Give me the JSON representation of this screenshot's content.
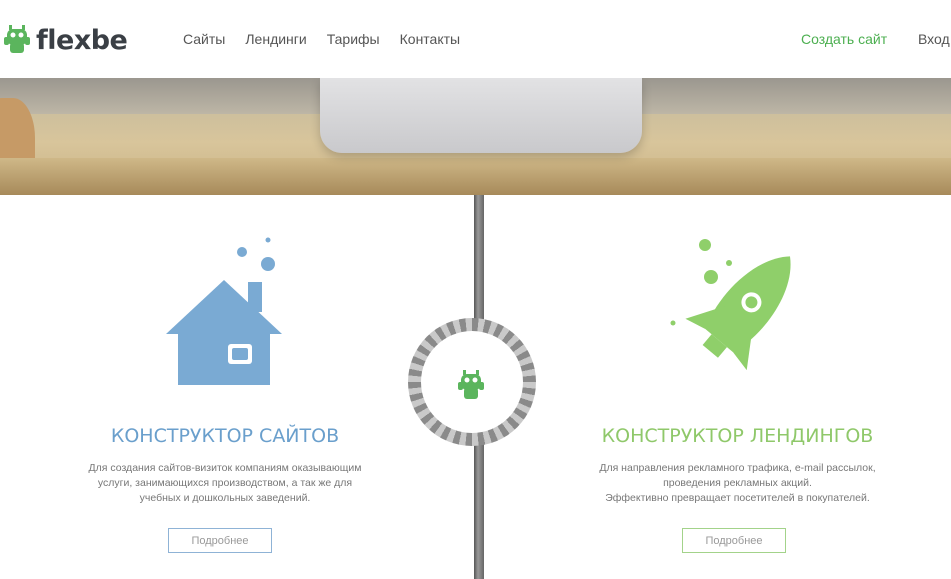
{
  "header": {
    "logo_text": "flexbe",
    "nav": [
      "Сайты",
      "Лендинги",
      "Тарифы",
      "Контакты"
    ],
    "create_site": "Создать сайт",
    "login": "Вход"
  },
  "left": {
    "title": "КОНСТРУКТОР САЙТОВ",
    "description_lines": [
      "Для создания сайтов-визиток компаниям оказывающим",
      "услуги, занимающихся производством, а так же для",
      "учебных и дошкольных заведений."
    ],
    "button": "Подробнее",
    "icon": "house-icon"
  },
  "right": {
    "title": "КОНСТРУКТОР ЛЕНДИНГОВ",
    "description_lines": [
      "Для направления рекламного трафика, e-mail рассылок,",
      "проведения рекламных акций.",
      "Эффективно превращает посетителей в покупателей."
    ],
    "button": "Подробнее",
    "icon": "rocket-icon"
  },
  "colors": {
    "brand_green": "#4caf50",
    "left_accent": "#6a9fcc",
    "right_accent": "#8fc86a"
  }
}
